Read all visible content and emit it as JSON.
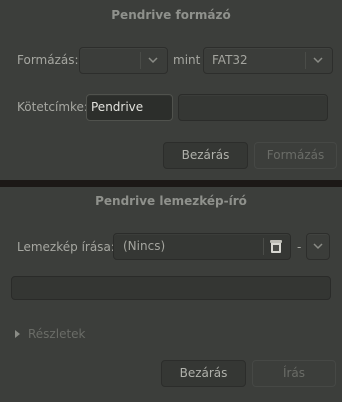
{
  "formatter": {
    "title": "Pendrive formázó",
    "format_label": "Formázás:",
    "format_value": "",
    "mint_label": "mint",
    "fs_value": "FAT32",
    "volume_label": "Kötetcímke:",
    "volume_value": "Pendrive",
    "volume_extra": "",
    "close_button": "Bezárás",
    "format_button": "Formázás"
  },
  "writer": {
    "title": "Pendrive lemezkép-író",
    "image_label": "Lemezkép írása:",
    "image_value": "(Nincs)",
    "to_label": "-",
    "target_value": "",
    "progress_value": "",
    "details_label": "Részletek",
    "close_button": "Bezárás",
    "write_button": "Írás"
  },
  "colors": {
    "dialog_bg": "#3c3e3b",
    "backdrop": "#1c1816",
    "text": "#a6a7a1",
    "disabled_text": "#6a6c67"
  }
}
